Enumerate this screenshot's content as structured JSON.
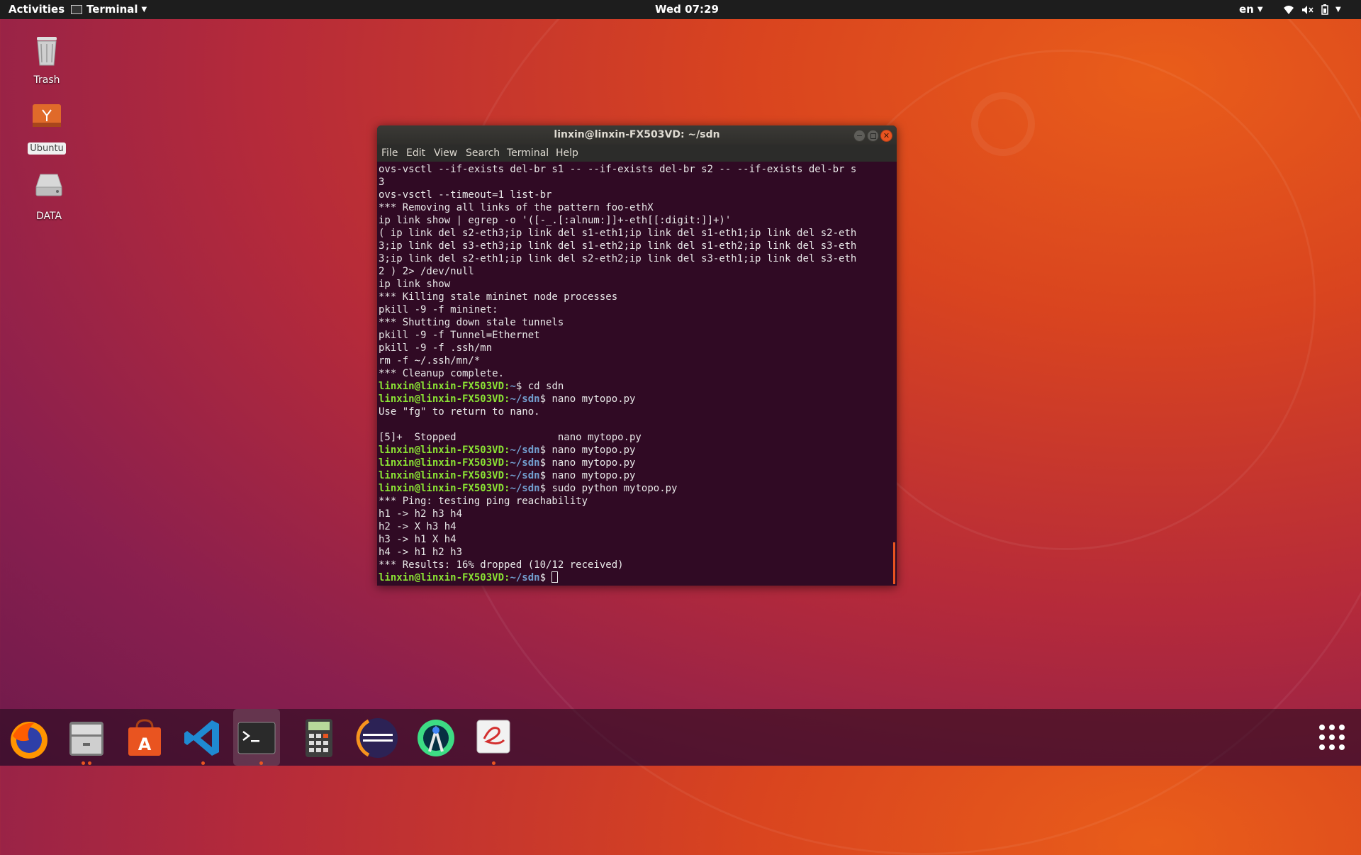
{
  "topbar": {
    "activities": "Activities",
    "app_menu": "Terminal",
    "clock": "Wed 07:29",
    "language": "en"
  },
  "desktop": {
    "icons": [
      {
        "label": "Trash",
        "icon": "trash-icon"
      },
      {
        "label": "Ubuntu",
        "icon": "ubuntu-drive-icon"
      },
      {
        "label": "DATA",
        "icon": "drive-icon"
      }
    ]
  },
  "terminal": {
    "title": "linxin@linxin-FX503VD: ~/sdn",
    "menu": [
      "File",
      "Edit",
      "View",
      "Search",
      "Terminal",
      "Help"
    ],
    "prompt_user": "linxin@linxin-FX503VD",
    "lines": [
      {
        "text": "ovs-vsctl --if-exists del-br s1 -- --if-exists del-br s2 -- --if-exists del-br s"
      },
      {
        "text": "3"
      },
      {
        "text": "ovs-vsctl --timeout=1 list-br"
      },
      {
        "text": "*** Removing all links of the pattern foo-ethX"
      },
      {
        "text": "ip link show | egrep -o '([-_.[:alnum:]]+-eth[[:digit:]]+)'"
      },
      {
        "text": "( ip link del s2-eth3;ip link del s1-eth1;ip link del s1-eth1;ip link del s2-eth"
      },
      {
        "text": "3;ip link del s3-eth3;ip link del s1-eth2;ip link del s1-eth2;ip link del s3-eth"
      },
      {
        "text": "3;ip link del s2-eth1;ip link del s2-eth2;ip link del s3-eth1;ip link del s3-eth"
      },
      {
        "text": "2 ) 2> /dev/null"
      },
      {
        "text": "ip link show"
      },
      {
        "text": "*** Killing stale mininet node processes"
      },
      {
        "text": "pkill -9 -f mininet:"
      },
      {
        "text": "*** Shutting down stale tunnels"
      },
      {
        "text": "pkill -9 -f Tunnel=Ethernet"
      },
      {
        "text": "pkill -9 -f .ssh/mn"
      },
      {
        "text": "rm -f ~/.ssh/mn/*"
      },
      {
        "text": "*** Cleanup complete."
      },
      {
        "path": "~",
        "cmd": " cd sdn"
      },
      {
        "path": "~/sdn",
        "cmd": " nano mytopo.py"
      },
      {
        "text": "Use \"fg\" to return to nano."
      },
      {
        "text": ""
      },
      {
        "text": "[5]+  Stopped                 nano mytopo.py"
      },
      {
        "path": "~/sdn",
        "cmd": " nano mytopo.py"
      },
      {
        "path": "~/sdn",
        "cmd": " nano mytopo.py"
      },
      {
        "path": "~/sdn",
        "cmd": " nano mytopo.py"
      },
      {
        "path": "~/sdn",
        "cmd": " sudo python mytopo.py"
      },
      {
        "text": "*** Ping: testing ping reachability"
      },
      {
        "text": "h1 -> h2 h3 h4"
      },
      {
        "text": "h2 -> X h3 h4"
      },
      {
        "text": "h3 -> h1 X h4"
      },
      {
        "text": "h4 -> h1 h2 h3"
      },
      {
        "text": "*** Results: 16% dropped (10/12 received)"
      },
      {
        "path": "~/sdn",
        "cmd": " ",
        "cursor": true
      }
    ]
  },
  "dock": {
    "items": [
      {
        "name": "firefox-icon",
        "running": false
      },
      {
        "name": "files-icon",
        "running": true
      },
      {
        "name": "software-center-icon",
        "running": false
      },
      {
        "name": "vscode-icon",
        "running": true
      },
      {
        "name": "terminal-icon",
        "running": true,
        "active": true
      },
      {
        "name": "calculator-icon",
        "running": false
      },
      {
        "name": "eclipse-icon",
        "running": false
      },
      {
        "name": "android-studio-icon",
        "running": false
      },
      {
        "name": "pdf-viewer-icon",
        "running": true
      },
      {
        "name": "show-applications-icon",
        "running": false
      }
    ]
  },
  "colors": {
    "accent": "#e95420",
    "terminal_bg": "#300a24",
    "prompt_user": "#8ae234",
    "prompt_path": "#729fcf"
  }
}
